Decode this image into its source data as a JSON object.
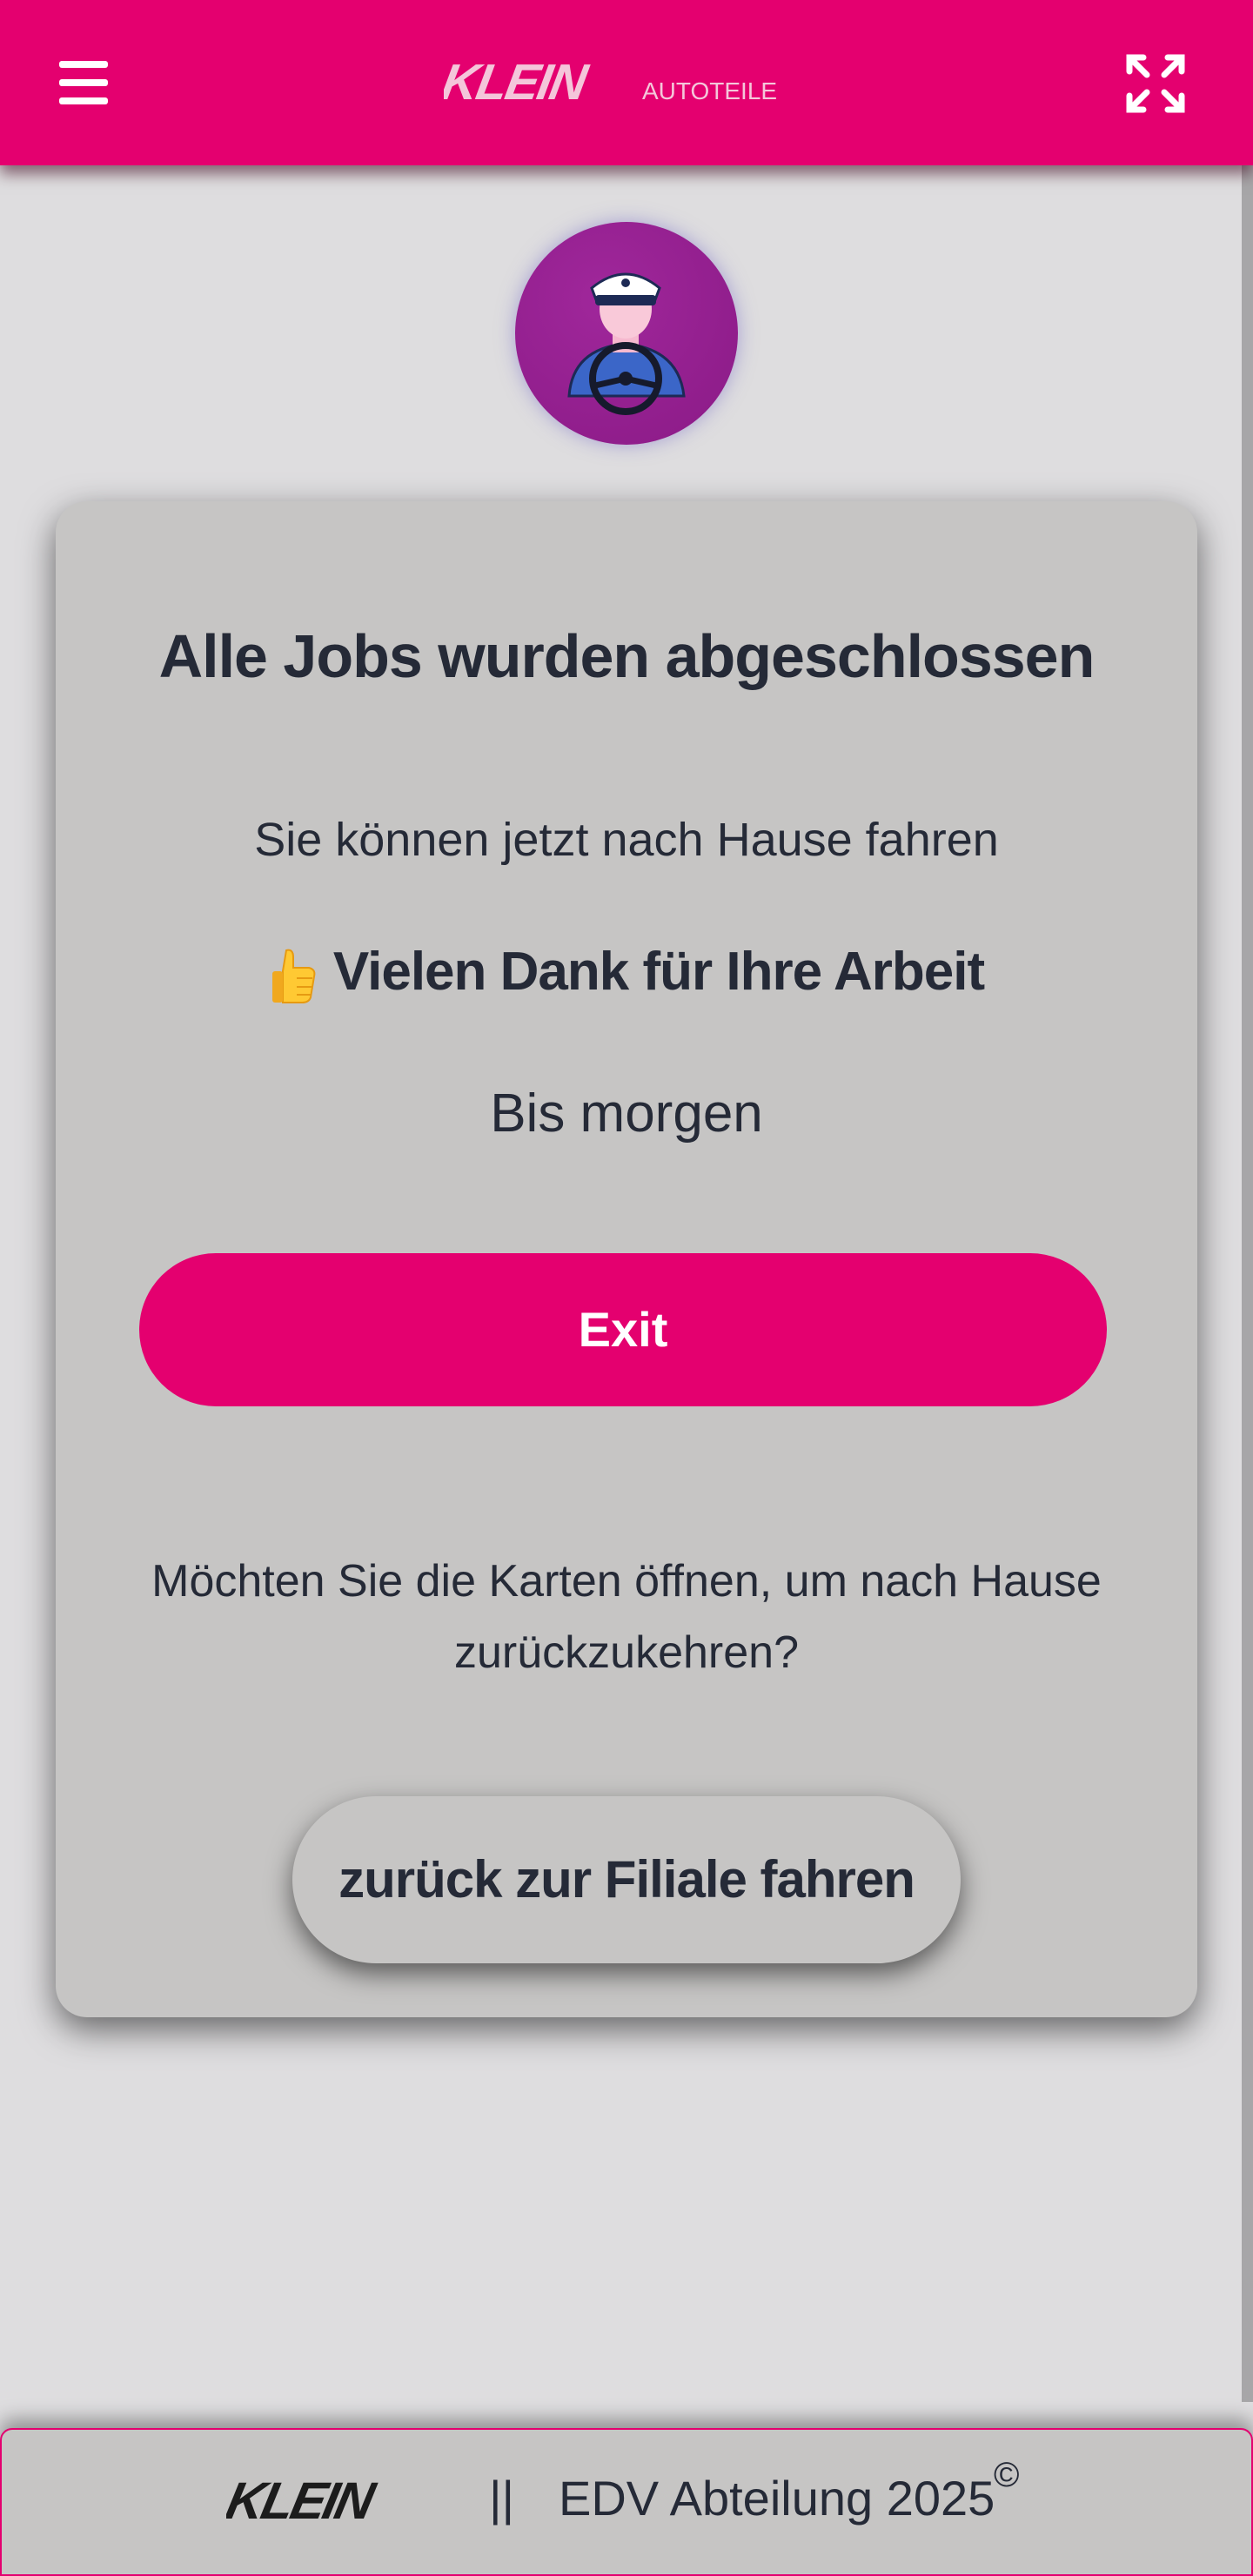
{
  "header": {
    "brand": "KLEIN",
    "brand_suffix": "AUTOTEILE",
    "menu_icon": "hamburger-menu-icon",
    "expand_icon": "fullscreen-expand-icon",
    "color": "#e4006f"
  },
  "avatar": {
    "icon": "driver-with-steering-wheel-icon"
  },
  "card": {
    "title": "Alle Jobs wurden abgeschlossen",
    "line1": "Sie können jetzt nach Hause fahren",
    "thanks_icon": "thumbs-up-icon",
    "thanks": "Vielen Dank für Ihre Arbeit",
    "bye": "Bis morgen",
    "exit_label": "Exit",
    "question": "Möchten Sie die Karten öffnen, um nach Hause zurückzukehren?",
    "home_button_label": "zurück zur Filiale fahren"
  },
  "footer": {
    "brand": "KLEIN",
    "separator": "||",
    "text": "EDV Abteilung 2025",
    "copyright": "©"
  }
}
